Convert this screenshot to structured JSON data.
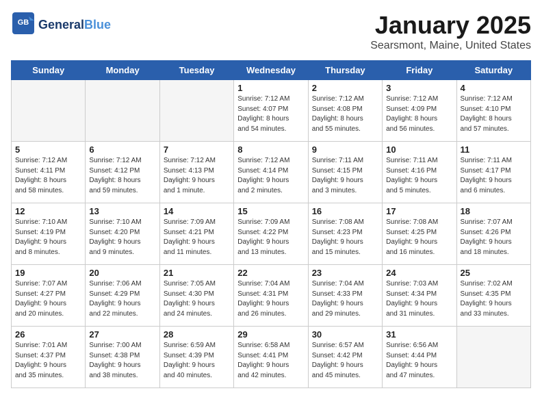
{
  "header": {
    "logo_line1": "General",
    "logo_line2": "Blue",
    "title": "January 2025",
    "subtitle": "Searsmont, Maine, United States"
  },
  "days_of_week": [
    "Sunday",
    "Monday",
    "Tuesday",
    "Wednesday",
    "Thursday",
    "Friday",
    "Saturday"
  ],
  "weeks": [
    [
      {
        "day": "",
        "info": ""
      },
      {
        "day": "",
        "info": ""
      },
      {
        "day": "",
        "info": ""
      },
      {
        "day": "1",
        "info": "Sunrise: 7:12 AM\nSunset: 4:07 PM\nDaylight: 8 hours\nand 54 minutes."
      },
      {
        "day": "2",
        "info": "Sunrise: 7:12 AM\nSunset: 4:08 PM\nDaylight: 8 hours\nand 55 minutes."
      },
      {
        "day": "3",
        "info": "Sunrise: 7:12 AM\nSunset: 4:09 PM\nDaylight: 8 hours\nand 56 minutes."
      },
      {
        "day": "4",
        "info": "Sunrise: 7:12 AM\nSunset: 4:10 PM\nDaylight: 8 hours\nand 57 minutes."
      }
    ],
    [
      {
        "day": "5",
        "info": "Sunrise: 7:12 AM\nSunset: 4:11 PM\nDaylight: 8 hours\nand 58 minutes."
      },
      {
        "day": "6",
        "info": "Sunrise: 7:12 AM\nSunset: 4:12 PM\nDaylight: 8 hours\nand 59 minutes."
      },
      {
        "day": "7",
        "info": "Sunrise: 7:12 AM\nSunset: 4:13 PM\nDaylight: 9 hours\nand 1 minute."
      },
      {
        "day": "8",
        "info": "Sunrise: 7:12 AM\nSunset: 4:14 PM\nDaylight: 9 hours\nand 2 minutes."
      },
      {
        "day": "9",
        "info": "Sunrise: 7:11 AM\nSunset: 4:15 PM\nDaylight: 9 hours\nand 3 minutes."
      },
      {
        "day": "10",
        "info": "Sunrise: 7:11 AM\nSunset: 4:16 PM\nDaylight: 9 hours\nand 5 minutes."
      },
      {
        "day": "11",
        "info": "Sunrise: 7:11 AM\nSunset: 4:17 PM\nDaylight: 9 hours\nand 6 minutes."
      }
    ],
    [
      {
        "day": "12",
        "info": "Sunrise: 7:10 AM\nSunset: 4:19 PM\nDaylight: 9 hours\nand 8 minutes."
      },
      {
        "day": "13",
        "info": "Sunrise: 7:10 AM\nSunset: 4:20 PM\nDaylight: 9 hours\nand 9 minutes."
      },
      {
        "day": "14",
        "info": "Sunrise: 7:09 AM\nSunset: 4:21 PM\nDaylight: 9 hours\nand 11 minutes."
      },
      {
        "day": "15",
        "info": "Sunrise: 7:09 AM\nSunset: 4:22 PM\nDaylight: 9 hours\nand 13 minutes."
      },
      {
        "day": "16",
        "info": "Sunrise: 7:08 AM\nSunset: 4:23 PM\nDaylight: 9 hours\nand 15 minutes."
      },
      {
        "day": "17",
        "info": "Sunrise: 7:08 AM\nSunset: 4:25 PM\nDaylight: 9 hours\nand 16 minutes."
      },
      {
        "day": "18",
        "info": "Sunrise: 7:07 AM\nSunset: 4:26 PM\nDaylight: 9 hours\nand 18 minutes."
      }
    ],
    [
      {
        "day": "19",
        "info": "Sunrise: 7:07 AM\nSunset: 4:27 PM\nDaylight: 9 hours\nand 20 minutes."
      },
      {
        "day": "20",
        "info": "Sunrise: 7:06 AM\nSunset: 4:29 PM\nDaylight: 9 hours\nand 22 minutes."
      },
      {
        "day": "21",
        "info": "Sunrise: 7:05 AM\nSunset: 4:30 PM\nDaylight: 9 hours\nand 24 minutes."
      },
      {
        "day": "22",
        "info": "Sunrise: 7:04 AM\nSunset: 4:31 PM\nDaylight: 9 hours\nand 26 minutes."
      },
      {
        "day": "23",
        "info": "Sunrise: 7:04 AM\nSunset: 4:33 PM\nDaylight: 9 hours\nand 29 minutes."
      },
      {
        "day": "24",
        "info": "Sunrise: 7:03 AM\nSunset: 4:34 PM\nDaylight: 9 hours\nand 31 minutes."
      },
      {
        "day": "25",
        "info": "Sunrise: 7:02 AM\nSunset: 4:35 PM\nDaylight: 9 hours\nand 33 minutes."
      }
    ],
    [
      {
        "day": "26",
        "info": "Sunrise: 7:01 AM\nSunset: 4:37 PM\nDaylight: 9 hours\nand 35 minutes."
      },
      {
        "day": "27",
        "info": "Sunrise: 7:00 AM\nSunset: 4:38 PM\nDaylight: 9 hours\nand 38 minutes."
      },
      {
        "day": "28",
        "info": "Sunrise: 6:59 AM\nSunset: 4:39 PM\nDaylight: 9 hours\nand 40 minutes."
      },
      {
        "day": "29",
        "info": "Sunrise: 6:58 AM\nSunset: 4:41 PM\nDaylight: 9 hours\nand 42 minutes."
      },
      {
        "day": "30",
        "info": "Sunrise: 6:57 AM\nSunset: 4:42 PM\nDaylight: 9 hours\nand 45 minutes."
      },
      {
        "day": "31",
        "info": "Sunrise: 6:56 AM\nSunset: 4:44 PM\nDaylight: 9 hours\nand 47 minutes."
      },
      {
        "day": "",
        "info": ""
      }
    ]
  ]
}
